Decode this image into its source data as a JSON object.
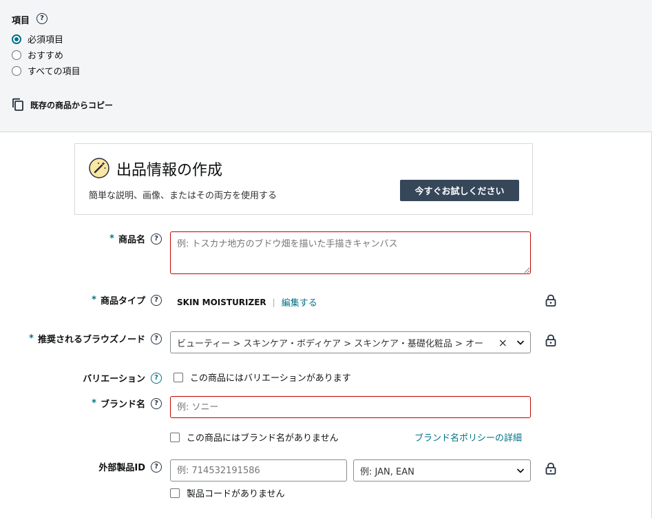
{
  "filter": {
    "title": "項目",
    "options": [
      {
        "label": "必須項目",
        "checked": true
      },
      {
        "label": "おすすめ",
        "checked": false
      },
      {
        "label": "すべての項目",
        "checked": false
      }
    ],
    "copy_label": "既存の商品からコピー"
  },
  "create_card": {
    "title": "出品情報の作成",
    "description": "簡単な説明、画像、またはその両方を使用する",
    "button": "今すぐお試しください"
  },
  "form": {
    "product_name": {
      "label": "商品名",
      "required": "*",
      "placeholder": "例: トスカナ地方のブドウ畑を描いた手描きキャンバス"
    },
    "product_type": {
      "label": "商品タイプ",
      "required": "*",
      "value": "SKIN MOISTURIZER",
      "separator": "|",
      "edit": "編集する"
    },
    "browse_node": {
      "label": "推奨されるブラウズノード",
      "required": "*",
      "value": "ビューティー > スキンケア・ボディケア > スキンケア・基礎化粧品 > オー",
      "clear": "×"
    },
    "variation": {
      "label": "バリエーション",
      "checkbox": "この商品にはバリエーションがあります"
    },
    "brand": {
      "label": "ブランド名",
      "required": "*",
      "placeholder": "例: ソニー",
      "checkbox": "この商品にはブランド名がありません",
      "policy_link": "ブランド名ポリシーの詳細"
    },
    "external_id": {
      "label": "外部製品ID",
      "placeholder": "例: 714532191586",
      "type_placeholder": "例: JAN, EAN",
      "checkbox": "製品コードがありません"
    }
  },
  "help_glyph": "?",
  "colors": {
    "accent": "#007185",
    "error": "#c40000",
    "button_bg": "#37475a",
    "panel_bg": "#f3f5f6"
  }
}
